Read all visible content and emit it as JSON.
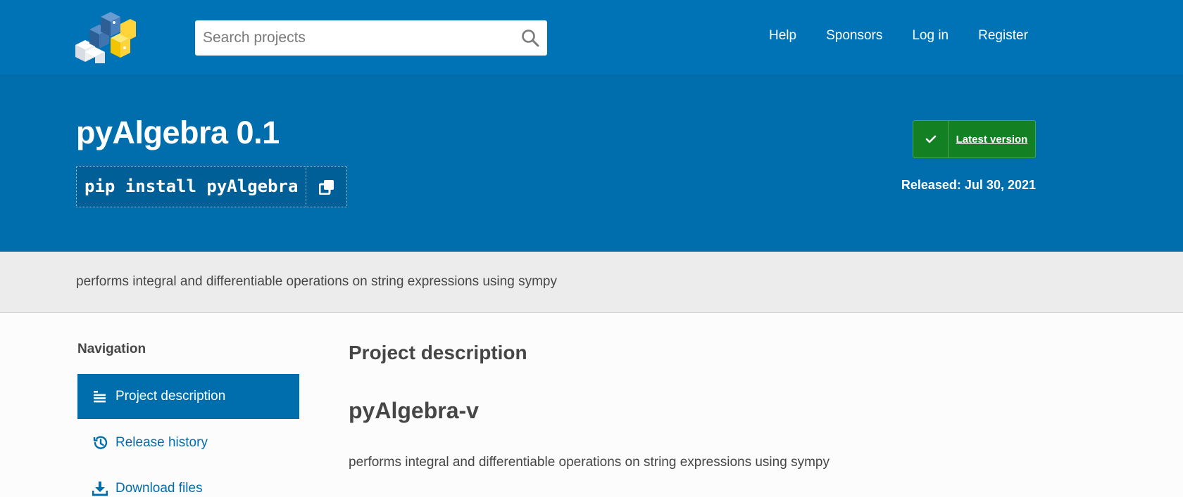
{
  "header": {
    "search_placeholder": "Search projects",
    "nav": [
      "Help",
      "Sponsors",
      "Log in",
      "Register"
    ]
  },
  "hero": {
    "title": "pyAlgebra 0.1",
    "pip_command": "pip install pyAlgebra",
    "latest_version_label": "Latest version",
    "released": "Released: Jul 30, 2021"
  },
  "summary": "performs integral and differentiable operations on string expressions using sympy",
  "sidebar": {
    "heading": "Navigation",
    "items": [
      {
        "label": "Project description",
        "icon": "align-left-icon",
        "active": true
      },
      {
        "label": "Release history",
        "icon": "history-icon",
        "active": false
      },
      {
        "label": "Download files",
        "icon": "download-icon",
        "active": false
      }
    ]
  },
  "main": {
    "section_heading": "Project description",
    "package_heading": "pyAlgebra-v",
    "package_text": "performs integral and differentiable operations on string expressions using sympy"
  },
  "colors": {
    "header_blue": "#0073b7",
    "hero_blue": "#006dad",
    "success_green": "#148024",
    "summary_gray": "#ececec"
  }
}
